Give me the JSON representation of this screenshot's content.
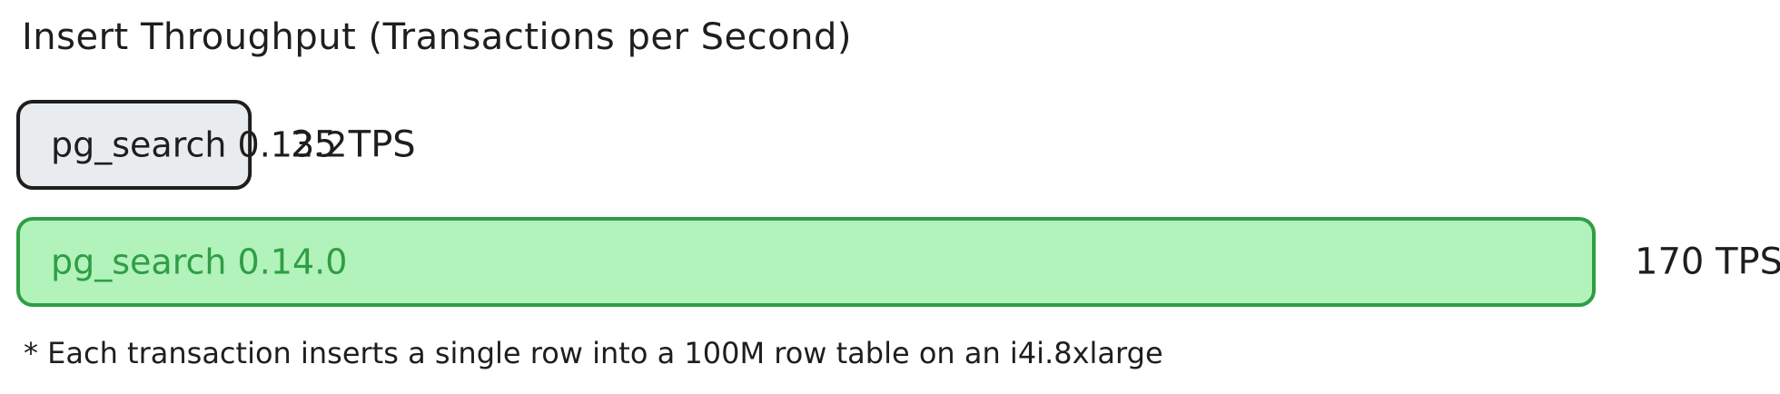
{
  "chart_data": {
    "type": "bar",
    "orientation": "horizontal",
    "title": "Insert Throughput (Transactions per Second)",
    "categories": [
      "pg_search 0.13.2",
      "pg_search 0.14.0"
    ],
    "values": [
      25,
      170
    ],
    "value_labels": [
      "25 TPS",
      "170 TPS"
    ],
    "bar_colors": [
      {
        "fill": "#e9ecef",
        "stroke": "#1e1e1e",
        "text": "#1e1e1e"
      },
      {
        "fill": "#b2f2bb",
        "stroke": "#2f9e44",
        "text": "#2f9e44"
      }
    ],
    "footnote": "* Each transaction inserts a single row into a 100M row table on an i4i.8xlarge",
    "xlim": [
      0,
      170
    ],
    "grid": false,
    "legend": "none"
  }
}
